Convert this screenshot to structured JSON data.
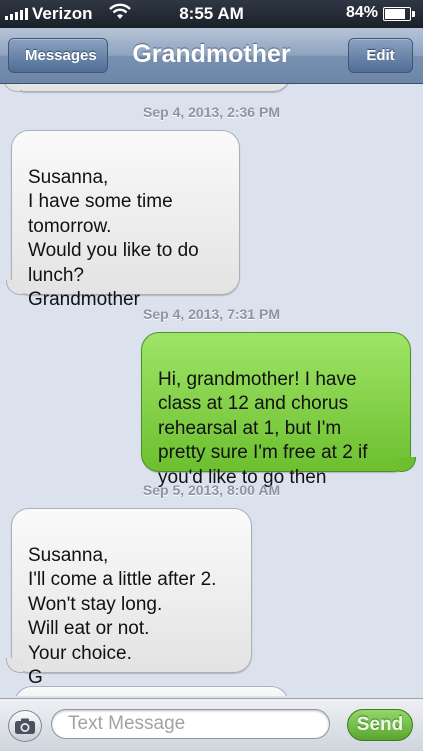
{
  "status_bar": {
    "carrier": "Verizon",
    "time": "8:55 AM",
    "battery_percent": "84%",
    "battery_level": 0.84
  },
  "nav": {
    "back_label": "Messages",
    "title": "Grandmother",
    "edit_label": "Edit"
  },
  "messages": [
    {
      "type": "timestamp",
      "text": "Sep 4, 2013, 2:36 PM"
    },
    {
      "type": "incoming",
      "text": "Susanna,\nI have some time\ntomorrow.\nWould you like to do\nlunch?\nGrandmother"
    },
    {
      "type": "timestamp",
      "text": "Sep 4, 2013, 7:31 PM"
    },
    {
      "type": "outgoing",
      "text": "Hi, grandmother! I have\nclass at 12 and chorus\nrehearsal at 1, but I'm\npretty sure I'm free at 2 if\nyou'd like to go then"
    },
    {
      "type": "timestamp",
      "text": "Sep 5, 2013, 8:00 AM"
    },
    {
      "type": "incoming",
      "text": "Susanna,\nI'll come a little after 2.\nWon't stay long.\n Will eat or not.\nYour choice.\nG"
    }
  ],
  "input_bar": {
    "placeholder": "Text Message",
    "send_label": "Send"
  },
  "colors": {
    "outgoing_bubble": "#7ccc3f",
    "incoming_bubble": "#ececec",
    "background": "#dbe2ed"
  }
}
